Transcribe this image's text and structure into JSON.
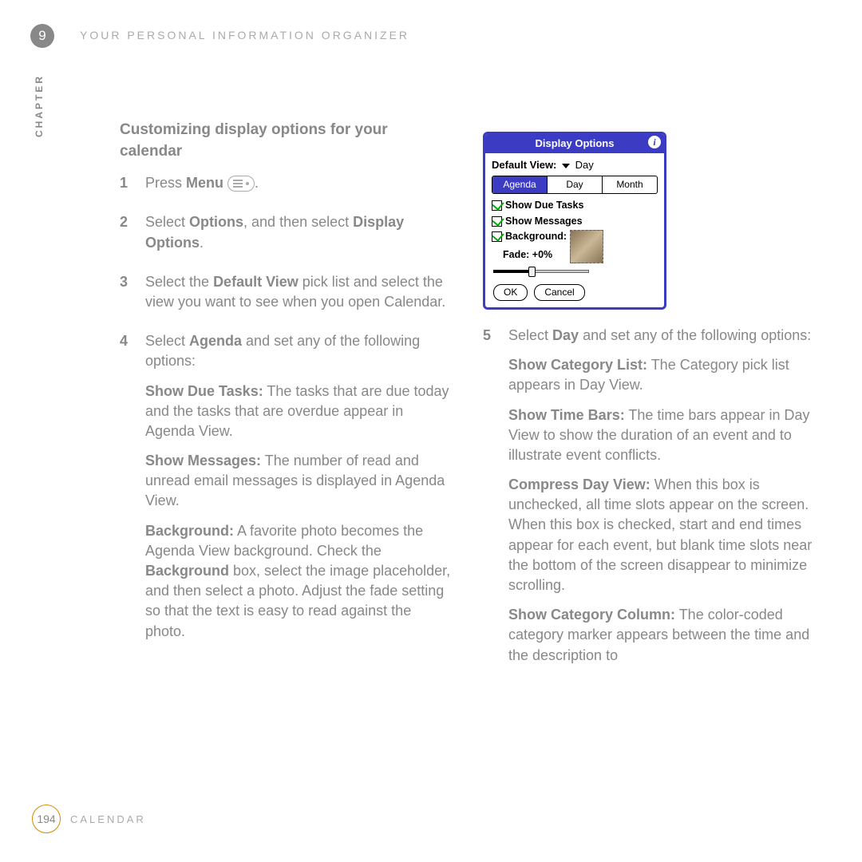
{
  "chapter": {
    "number": "9",
    "label": "CHAPTER"
  },
  "header": "YOUR PERSONAL INFORMATION ORGANIZER",
  "sectionHeading": "Customizing display options for your calendar",
  "step1": {
    "n": "1",
    "a": "Press ",
    "b": "Menu",
    "c": "."
  },
  "step2": {
    "n": "2",
    "a": "Select ",
    "b": "Options",
    "c": ", and then select ",
    "d": "Display Options",
    "e": "."
  },
  "step3": {
    "n": "3",
    "a": "Select the ",
    "b": "Default View",
    "c": " pick list and select the view you want to see when you open Calendar."
  },
  "step4": {
    "n": "4",
    "a": "Select ",
    "b": "Agenda",
    "c": " and set any of the following options:",
    "showDueTasks": {
      "t": "Show Due Tasks:",
      "d": " The tasks that are due today and the tasks that are overdue appear in Agenda View."
    },
    "showMessages": {
      "t": "Show Messages:",
      "d": " The number of read and unread email messages is displayed in Agenda View."
    },
    "background": {
      "t": "Background:",
      "d1": " A favorite photo becomes the Agenda View background. Check the ",
      "b": "Background",
      "d2": " box, select the image placeholder, and then select a photo. Adjust the fade setting so that the text is easy to read against the photo."
    }
  },
  "step5": {
    "n": "5",
    "a": "Select ",
    "b": "Day",
    "c": " and set any of the following options:",
    "showCatList": {
      "t": "Show Category List:",
      "d": " The Category pick list appears in Day View."
    },
    "showTimeBars": {
      "t": "Show Time Bars:",
      "d": " The time bars appear in Day View to show the duration of an event and to illustrate event conflicts."
    },
    "compress": {
      "t": "Compress Day View:",
      "d": " When this box is unchecked, all time slots appear on the screen. When this box is checked, start and end times appear for each event, but blank time slots near the bottom of the screen disappear to minimize scrolling."
    },
    "showCatCol": {
      "t": "Show Category Column:",
      "d": " The color-coded category marker appears between the time and the description to"
    }
  },
  "dialog": {
    "title": "Display Options",
    "defaultViewLabel": "Default View:",
    "defaultViewValue": "Day",
    "tabs": [
      "Agenda",
      "Day",
      "Month"
    ],
    "chkDueTasks": "Show Due Tasks",
    "chkMessages": "Show Messages",
    "chkBackground": "Background:",
    "fadeLabel": "Fade:  +0%",
    "ok": "OK",
    "cancel": "Cancel"
  },
  "footer": {
    "page": "194",
    "label": "CALENDAR"
  }
}
